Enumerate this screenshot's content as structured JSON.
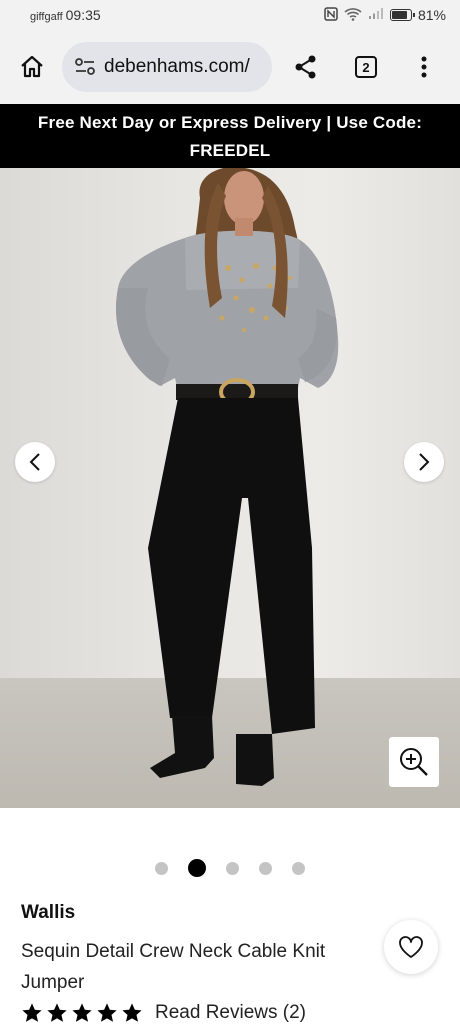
{
  "status_bar": {
    "carrier": "giffgaff",
    "time": "09:35",
    "battery": "81%",
    "battery_level": 0.81
  },
  "browser": {
    "url": "debenhams.com/",
    "tab_count": "2"
  },
  "promo": {
    "line1": "Free Next Day or Express Delivery | Use Code:",
    "line2": "FREEDEL"
  },
  "gallery": {
    "image_count": 5,
    "active_index": 1
  },
  "product": {
    "brand": "Wallis",
    "name": "Sequin Detail Crew Neck Cable Knit Jumper",
    "rating": 5,
    "reviews_label": "Read Reviews (2)"
  },
  "icons": [
    "home-icon",
    "site-settings-icon",
    "share-icon",
    "tabs-icon",
    "more-vert-icon",
    "chevron-left-icon",
    "chevron-right-icon",
    "zoom-in-icon",
    "heart-icon",
    "star-icon"
  ]
}
